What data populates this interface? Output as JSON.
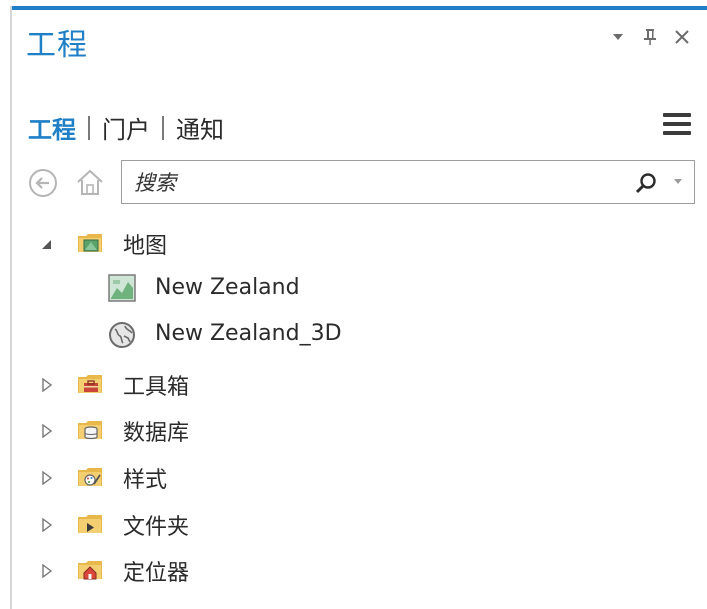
{
  "pane": {
    "title": "工程",
    "controls": [
      "menu-dropdown-icon",
      "pin-icon",
      "close-icon"
    ]
  },
  "tabs": [
    {
      "label": "工程",
      "active": true
    },
    {
      "label": "门户",
      "active": false
    },
    {
      "label": "通知",
      "active": false
    }
  ],
  "search": {
    "placeholder": "搜索",
    "value": ""
  },
  "tree": {
    "map_folder": {
      "label": "地图",
      "expanded": true,
      "children": [
        {
          "label": "New Zealand",
          "icon": "map-icon"
        },
        {
          "label": "New Zealand_3D",
          "icon": "globe-icon"
        }
      ]
    },
    "toolbox": {
      "label": "工具箱",
      "expanded": false
    },
    "database": {
      "label": "数据库",
      "expanded": false
    },
    "styles": {
      "label": "样式",
      "expanded": false
    },
    "folders": {
      "label": "文件夹",
      "expanded": false
    },
    "locators": {
      "label": "定位器",
      "expanded": false
    }
  },
  "colors": {
    "accent": "#1f80c8",
    "folder": "#e8b84a",
    "text": "#2b2b2b"
  }
}
